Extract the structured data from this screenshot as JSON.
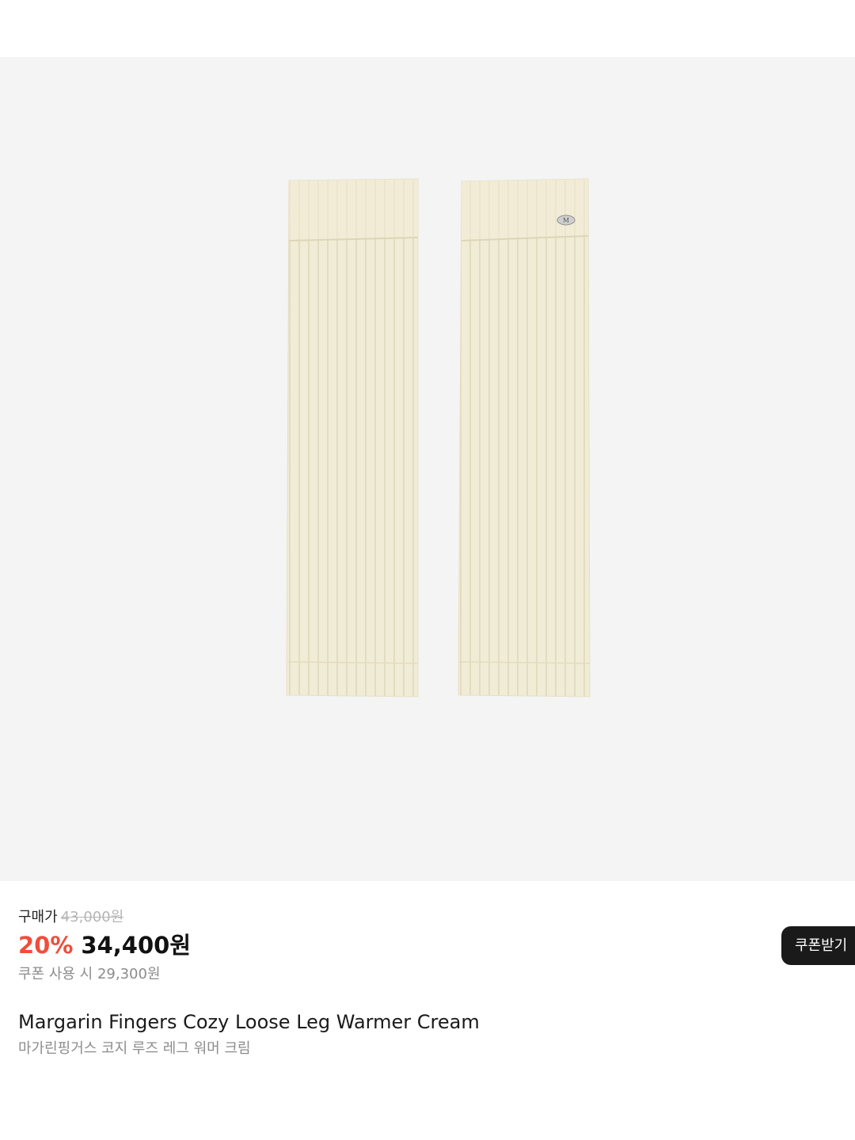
{
  "price": {
    "purchase_label": "구매가",
    "original_price": "43,000원",
    "discount_rate": "20%",
    "sale_price": "34,400원",
    "coupon_price_text": "쿠폰 사용 시 29,300원"
  },
  "coupon_button": {
    "label": "쿠폰받기"
  },
  "product": {
    "name_en": "Margarin Fingers Cozy Loose Leg Warmer Cream",
    "name_ko": "마가린핑거스 코지 루즈 레그 워머 크림",
    "image_subject": "cream-leg-warmers",
    "image_tag_text": "M"
  },
  "colors": {
    "discount": "#ef4e3a",
    "image_background": "#f4f4f4",
    "product_cream": "#f1ecd6",
    "button_background": "#1a1a1a"
  }
}
